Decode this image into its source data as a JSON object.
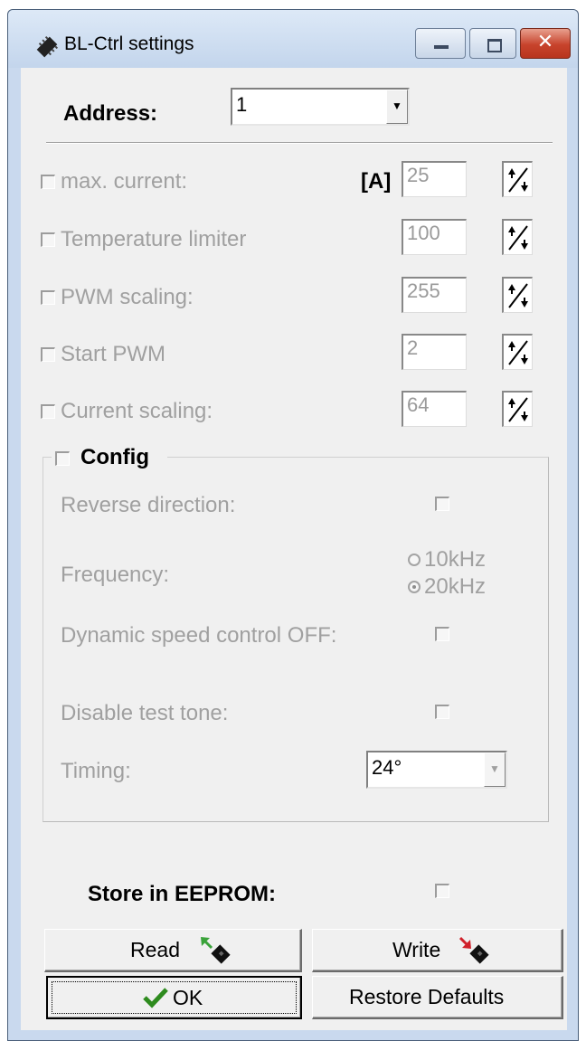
{
  "window": {
    "title": "BL-Ctrl settings"
  },
  "address": {
    "label": "Address:",
    "value": "1"
  },
  "settings": [
    {
      "label": "max. current:",
      "unit": "[A]",
      "value": "25"
    },
    {
      "label": "Temperature limiter",
      "value": "100"
    },
    {
      "label": "PWM scaling:",
      "value": "255"
    },
    {
      "label": "Start PWM",
      "value": "2"
    },
    {
      "label": "Current scaling:",
      "value": "64"
    }
  ],
  "config": {
    "label": "Config",
    "reverse_label": "Reverse direction:",
    "frequency_label": "Frequency:",
    "freq_options": [
      "10kHz",
      "20kHz"
    ],
    "freq_selected": "20kHz",
    "dynamic_label": "Dynamic speed control OFF:",
    "test_tone_label": "Disable test tone:",
    "timing_label": "Timing:",
    "timing_value": "24°"
  },
  "eeprom": {
    "label": "Store in EEPROM:"
  },
  "buttons": {
    "read": "Read",
    "write": "Write",
    "ok": "OK",
    "restore": "Restore Defaults"
  },
  "colors": {
    "disabled_text": "#a0a0a0",
    "ok_check": "#2e8b1e",
    "read_arrow": "#3aa33a",
    "write_arrow": "#d0202a"
  }
}
